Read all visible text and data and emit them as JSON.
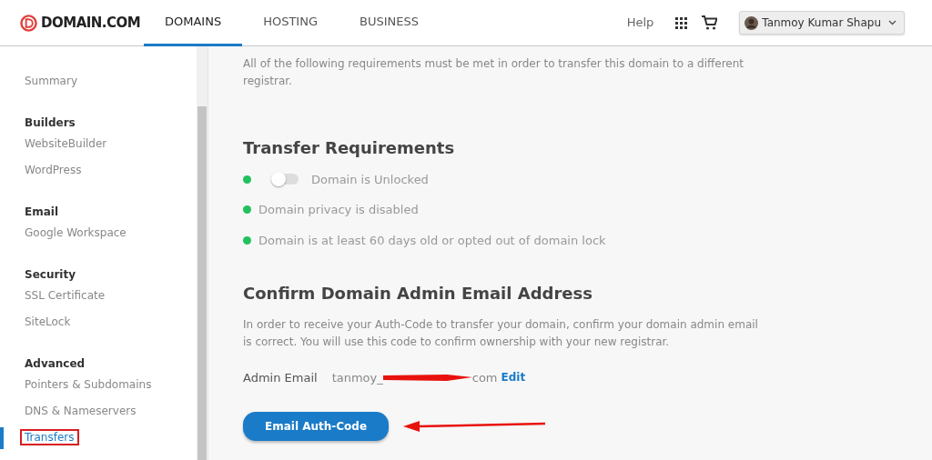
{
  "header": {
    "logo": "DOMAIN.COM",
    "tabs": [
      {
        "label": "DOMAINS",
        "selected": true
      },
      {
        "label": "HOSTING",
        "selected": false
      },
      {
        "label": "BUSINESS",
        "selected": false
      }
    ],
    "help": "Help",
    "user": "Tanmoy Kumar Shapu"
  },
  "sidebar": {
    "sections": [
      {
        "items": [
          {
            "label": "Summary",
            "selected": false
          }
        ]
      },
      {
        "heading": "Builders",
        "items": [
          {
            "label": "WebsiteBuilder",
            "selected": false
          },
          {
            "label": "WordPress",
            "selected": false
          }
        ]
      },
      {
        "heading": "Email",
        "items": [
          {
            "label": "Google Workspace",
            "selected": false
          }
        ]
      },
      {
        "heading": "Security",
        "items": [
          {
            "label": "SSL Certificate",
            "selected": false
          },
          {
            "label": "SiteLock",
            "selected": false
          }
        ]
      },
      {
        "heading": "Advanced",
        "items": [
          {
            "label": "Pointers & Subdomains",
            "selected": false
          },
          {
            "label": "DNS & Nameservers",
            "selected": false
          },
          {
            "label": "Transfers",
            "selected": true
          }
        ]
      }
    ]
  },
  "intro": "All of the following requirements must be met in order to transfer this domain to a different registrar.",
  "requirements": {
    "title": "Transfer Requirements",
    "items": [
      {
        "kind": "toggle",
        "label": "Domain is Unlocked",
        "met": true,
        "on": false
      },
      {
        "kind": "plain",
        "label": "Domain privacy is disabled",
        "met": true
      },
      {
        "kind": "plain",
        "label": "Domain is at least 60 days old or opted out of domain lock",
        "met": true
      }
    ]
  },
  "confirm": {
    "title": "Confirm Domain Admin Email Address",
    "text": "In order to receive your Auth-Code to transfer your domain, confirm your domain admin email is correct. You will use this code to confirm ownership with your new registrar.",
    "email_label": "Admin Email",
    "email_start": "tanmoy_",
    "email_end": "com",
    "edit": "Edit",
    "button": "Email Auth-Code"
  }
}
